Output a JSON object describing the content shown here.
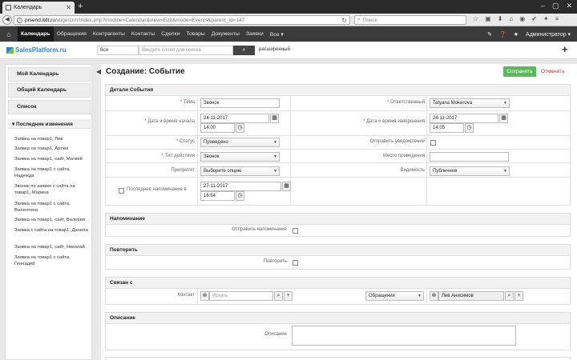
{
  "browser": {
    "tab_title": "Календарь",
    "url_domain": "prsend.itdt.ru",
    "url_path": "/vtigercrm/index.php?module=Calendar&view=Edit&mode=Events&parent_id=147",
    "search_placeholder": "Поиск"
  },
  "nav": {
    "items": [
      "Календарь",
      "Обращения",
      "Контрагенты",
      "Контакты",
      "Сделки",
      "Товары",
      "Документы",
      "Заявки",
      "Все ▾"
    ],
    "user": "Администратор ▾"
  },
  "search": {
    "logo": "SalesPlatform.ru",
    "scope": "Все",
    "placeholder": "Введите слово для поиска",
    "advanced": "расширенный"
  },
  "sidebar": {
    "my_calendar": "Мой Календарь",
    "shared_calendar": "Общий Календарь",
    "list": "Список",
    "recent_title": "Последние изменения",
    "recent": [
      "Заявка на товар1, Лев",
      "Заявка на товар1, Артём",
      "Заявка на товар1, сайт, Матвей",
      "Заявка на товар1 с сайта, Надежда",
      "Звонок по заявке с сайта на товар1, Марина",
      "Заявка на товар1 с сайта, Валентина",
      "Заявка на товар1, сайт, Валерия",
      "Заявка с сайта на товар1, Данила",
      "Заявка на товар1, сайт, Николай",
      "Заявка на товар1 с сайта, Геннадий"
    ]
  },
  "page": {
    "title": "Создание: Событие",
    "save": "Сохранить",
    "cancel": "Отменить"
  },
  "details": {
    "header": "Детали События",
    "subject_label": "Тема",
    "subject": "Звонок",
    "assigned_label": "Ответственный",
    "assigned": "Tatyana Mokerova",
    "start_label": "Дата и время начала",
    "start_date": "24-11-2017",
    "start_time": "14:00",
    "end_label": "Дата и время завершения",
    "end_date": "24-11-2017",
    "end_time": "14:05",
    "status_label": "Статус",
    "status": "Проведено",
    "notify_label": "Отправить уведомление",
    "action_type_label": "Тип действия",
    "action_type": "Звонок",
    "location_label": "Место проведения",
    "priority_label": "Приоритет",
    "priority": "Выберите опцию",
    "visibility_label": "Видимость",
    "visibility": "Публичное",
    "reminder_label": "Последнее напоминание в",
    "reminder_date": "27-11-2017",
    "reminder_time": "16:54"
  },
  "reminder": {
    "header": "Напоминание",
    "label": "Отправить напоминание"
  },
  "repeat": {
    "header": "Повторить",
    "label": "Повторить"
  },
  "related": {
    "header": "Связан с",
    "contact_label": "Контакт",
    "contact_placeholder": "Искать",
    "type": "Обращения",
    "value": "Лев Анисимов"
  },
  "description": {
    "header": "Описание",
    "label": "Описание"
  }
}
